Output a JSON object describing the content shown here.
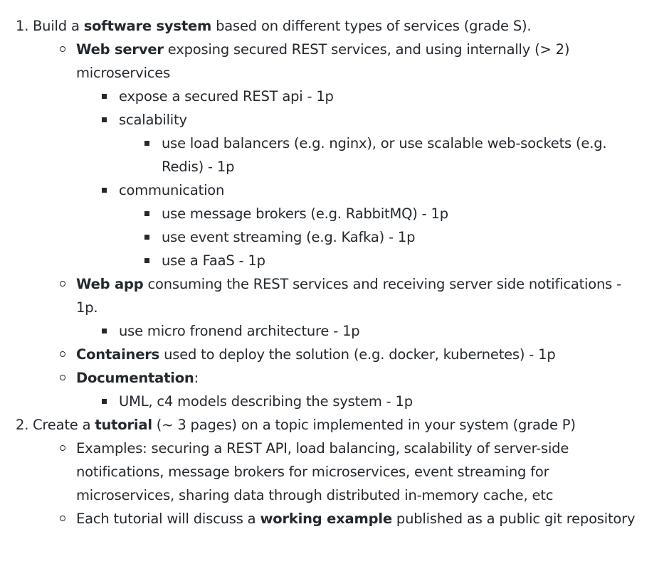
{
  "items": [
    {
      "marker": "1.",
      "pre": "Build a ",
      "bold": "software system",
      "post": " based on different types of services (grade S).",
      "children": [
        {
          "bold": "Web server",
          "post": " exposing secured REST services, and using internally (> 2) microservices",
          "children": [
            {
              "text": "expose a secured REST api - 1p"
            },
            {
              "text": "scalability",
              "children": [
                {
                  "text": "use load balancers (e.g. nginx), or use scalable web-sockets (e.g. Redis) - 1p"
                }
              ]
            },
            {
              "text": "communication",
              "children": [
                {
                  "text": "use message brokers (e.g. RabbitMQ) - 1p"
                },
                {
                  "text": "use event streaming (e.g. Kafka) - 1p"
                },
                {
                  "text": "use a FaaS - 1p"
                }
              ]
            }
          ]
        },
        {
          "bold": "Web app",
          "post": " consuming the REST services and receiving server side notifications - 1p.",
          "children": [
            {
              "text": "use micro fronend architecture - 1p"
            }
          ]
        },
        {
          "bold": "Containers",
          "post": " used to deploy the solution (e.g. docker, kubernetes) - 1p"
        },
        {
          "bold": "Documentation",
          "post": ":",
          "children": [
            {
              "text": "UML, c4 models describing the system - 1p"
            }
          ]
        }
      ]
    },
    {
      "marker": "2.",
      "pre": "Create a ",
      "bold": "tutorial",
      "post": " (~ 3 pages) on a topic implemented in your system (grade P)",
      "children": [
        {
          "pre": "Examples: securing a REST API, load balancing, scalability of server-side notifications, message brokers for microservices, event streaming for microservices, sharing data through distributed in-memory cache, etc"
        },
        {
          "pre": "Each tutorial will discuss a ",
          "bold": "working example",
          "post": " published as a public git repository"
        }
      ]
    }
  ]
}
